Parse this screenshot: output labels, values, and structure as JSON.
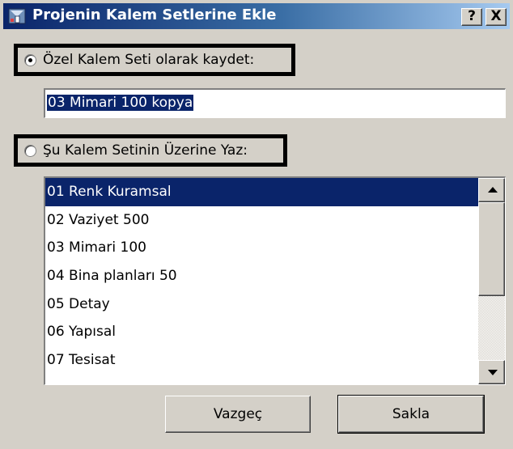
{
  "window": {
    "title": "Projenin Kalem Setlerine Ekle",
    "help_label": "?",
    "close_label": "X"
  },
  "options": {
    "save_as_custom_label": "Özel Kalem Seti olarak kaydet:",
    "save_as_custom_selected": true,
    "overwrite_label": "Şu Kalem Setinin Üzerine Yaz:",
    "overwrite_selected": false
  },
  "name_field": {
    "value": "03 Mimari 100 kopya"
  },
  "pen_sets": {
    "items": [
      "01 Renk Kuramsal",
      "02 Vaziyet 500",
      "03 Mimari 100",
      "04 Bina planları 50",
      "05 Detay",
      "06 Yapısal",
      "07 Tesisat"
    ],
    "selected_index": 0
  },
  "buttons": {
    "cancel_label": "Vazgeç",
    "save_label": "Sakla"
  },
  "colors": {
    "selection": "#0a246a",
    "face": "#d4d0c8"
  }
}
